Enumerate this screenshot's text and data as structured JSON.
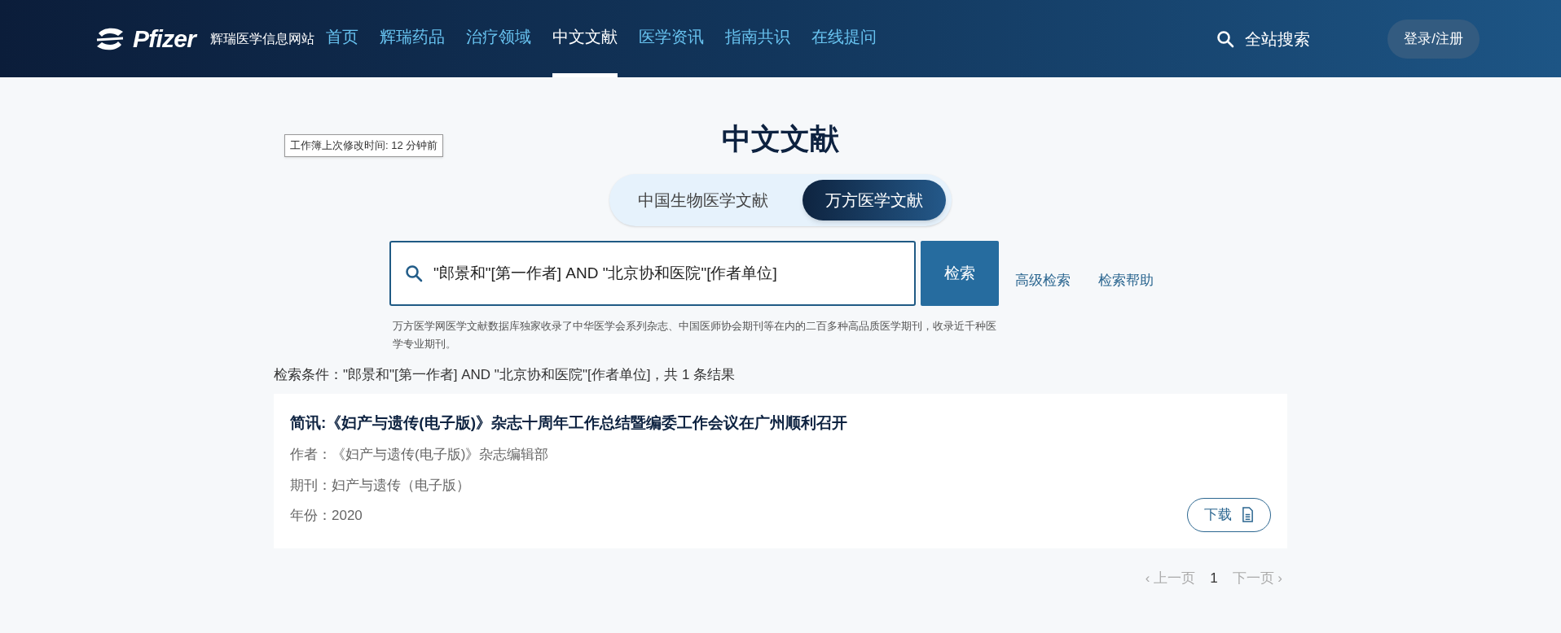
{
  "header": {
    "logo": "Pfizer",
    "site_name": "辉瑞医学信息网站",
    "nav": [
      {
        "label": "首页",
        "selected": false
      },
      {
        "label": "辉瑞药品",
        "selected": false
      },
      {
        "label": "治疗领域",
        "selected": false
      },
      {
        "label": "中文文献",
        "selected": true
      },
      {
        "label": "医学资讯",
        "selected": false
      },
      {
        "label": "指南共识",
        "selected": false
      },
      {
        "label": "在线提问",
        "selected": false
      }
    ],
    "search": "全站搜索",
    "login": "登录/注册"
  },
  "tooltip": "工作簿上次修改时间: 12 分钟前",
  "title": "中文文献",
  "tabs": [
    {
      "label": "中国生物医学文献",
      "selected": false
    },
    {
      "label": "万方医学文献",
      "selected": true
    }
  ],
  "search": {
    "value": "\"郎景和\"[第一作者] AND \"北京协和医院\"[作者单位]",
    "button": "检索",
    "links": [
      "高级检索",
      "检索帮助"
    ],
    "description": "万方医学网医学文献数据库独家收录了中华医学会系列杂志、中国医师协会期刊等在内的二百多种高品质医学期刊，收录近千种医学专业期刊。"
  },
  "conditions": "检索条件：\"郎景和\"[第一作者] AND \"北京协和医院\"[作者单位]，共 1 条结果",
  "results": [
    {
      "title": "简讯:《妇产与遗传(电子版)》杂志十周年工作总结暨编委工作会议在广州顺利召开",
      "author": "作者：《妇产与遗传(电子版)》杂志编辑部",
      "journal": "期刊：妇产与遗传（电子版）",
      "year": "年份：2020",
      "download": "下载"
    }
  ],
  "pagination": {
    "prev": "‹ 上一页",
    "pages": [
      {
        "label": "1",
        "selected": true
      }
    ],
    "next": "下一页 ›"
  }
}
